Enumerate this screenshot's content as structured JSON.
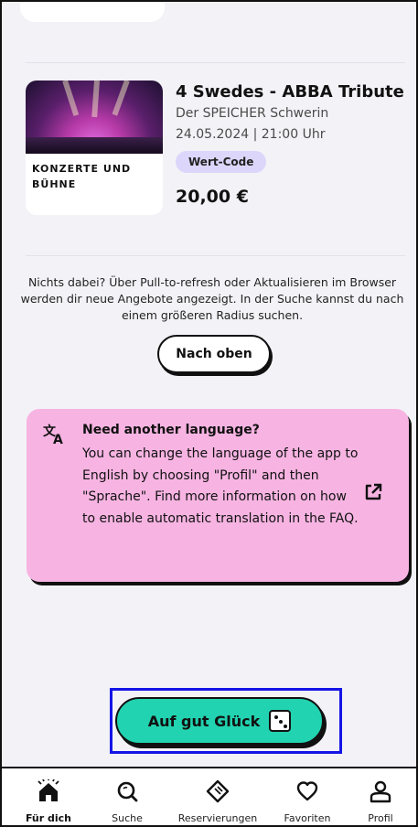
{
  "event": {
    "category": "KONZERTE UND BÜHNE",
    "title": "4 Swedes - ABBA Tribute",
    "venue": "Der SPEICHER Schwerin",
    "datetime": "24.05.2024 | 21:00 Uhr",
    "badge": "Wert-Code",
    "price": "20,00 €"
  },
  "info": {
    "text": "Nichts dabei? Über Pull-to-refresh oder Aktualisieren im Browser werden dir neue Angebote angezeigt. In der Suche kannst du nach einem größeren Radius suchen.",
    "to_top_label": "Nach oben"
  },
  "language_card": {
    "title": "Need another language?",
    "body": "You can change the language of the app to English by choosing \"Profil\" and then \"Sprache\". Find more information on how to enable automatic translation in the FAQ.",
    "icon": "translate-icon",
    "link_icon": "external-link-icon",
    "bg_color": "#f7b4e2"
  },
  "lucky": {
    "label": "Auf gut Glück",
    "icon": "dice-icon",
    "color": "#21d3b0"
  },
  "nav": {
    "items": [
      {
        "label": "Für dich",
        "icon": "home-icon",
        "active": true
      },
      {
        "label": "Suche",
        "icon": "search-icon",
        "active": false
      },
      {
        "label": "Reservierungen",
        "icon": "ticket-icon",
        "active": false
      },
      {
        "label": "Favoriten",
        "icon": "heart-icon",
        "active": false
      },
      {
        "label": "Profil",
        "icon": "profile-icon",
        "active": false
      }
    ]
  }
}
